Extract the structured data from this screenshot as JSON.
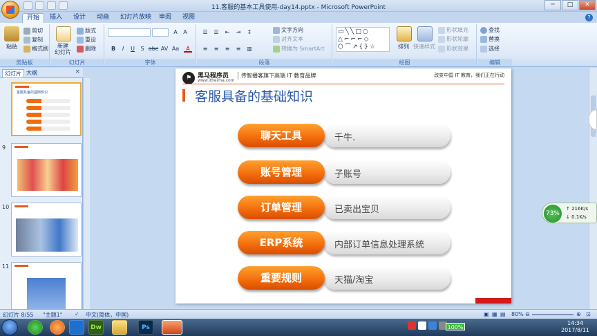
{
  "window": {
    "title": "11.客服的基本工具使用-day14.pptx - Microsoft PowerPoint",
    "controls": [
      "─",
      "□",
      "✕"
    ]
  },
  "ribbon": {
    "tabs": [
      "开始",
      "插入",
      "设计",
      "动画",
      "幻灯片放映",
      "审阅",
      "视图"
    ],
    "groups": {
      "clipboard": {
        "label": "剪贴板",
        "paste": "粘贴",
        "cut": "剪切",
        "copy": "复制",
        "format_painter": "格式刷"
      },
      "slides": {
        "label": "幻灯片",
        "new_slide": "新建\n幻灯片",
        "layout": "版式",
        "reset": "重设",
        "delete": "删除"
      },
      "font": {
        "label": "字体",
        "buttons": [
          "B",
          "I",
          "U",
          "S",
          "abc",
          "AV",
          "Aa",
          "A"
        ]
      },
      "paragraph": {
        "label": "段落",
        "text_direction": "文字方向",
        "align_text": "对齐文本",
        "smartart": "转换为 SmartArt"
      },
      "drawing": {
        "label": "绘图",
        "arrange": "排列",
        "quick_styles": "快速样式",
        "shape_fill": "形状填充",
        "shape_outline": "形状轮廓",
        "shape_effects": "形状效果"
      },
      "editing": {
        "label": "编辑",
        "find": "查找",
        "replace": "替换",
        "select": "选择"
      }
    }
  },
  "left_panel": {
    "tabs": [
      "幻灯片",
      "大纲"
    ],
    "close": "×",
    "thumbnails": [
      {
        "number": "",
        "title": "客服具备的基础知识"
      },
      {
        "number": "9",
        "title": ""
      },
      {
        "number": "10",
        "title": ""
      },
      {
        "number": "11",
        "title": ""
      }
    ]
  },
  "slide": {
    "brand": "黑马程序员",
    "brand_url": "www.itheima.com",
    "brand_tag": "传智播客旗下高端 IT 教育品牌",
    "slogan": "改变中国 IT 教育，我们正在行动",
    "title": "客服具备的基础知识",
    "rows": [
      {
        "label": "聊天工具",
        "value": "千牛."
      },
      {
        "label": "账号管理",
        "value": "子账号"
      },
      {
        "label": "订单管理",
        "value": "已卖出宝贝"
      },
      {
        "label": "ERP系统",
        "value": "内部订单信息处理系统"
      },
      {
        "label": "重要规则",
        "value": "天猫/淘宝"
      }
    ]
  },
  "net_widget": {
    "percent": "73%",
    "up": "216K/s",
    "down": "0.1K/s"
  },
  "status_bar": {
    "slide_info": "幻灯片 8/55",
    "theme": "\"主题1\"",
    "language": "中文(简体，中国)",
    "zoom": "80%"
  },
  "taskbar": {
    "apps": [
      "",
      "",
      "",
      "Dw",
      "",
      "Ps",
      ""
    ],
    "battery": "100%",
    "time": "14:34",
    "date": "2017/8/11"
  },
  "colors": {
    "accent_orange": "#f26b0c",
    "title_blue": "#2a5aa8",
    "ribbon_blue": "#15428b"
  }
}
